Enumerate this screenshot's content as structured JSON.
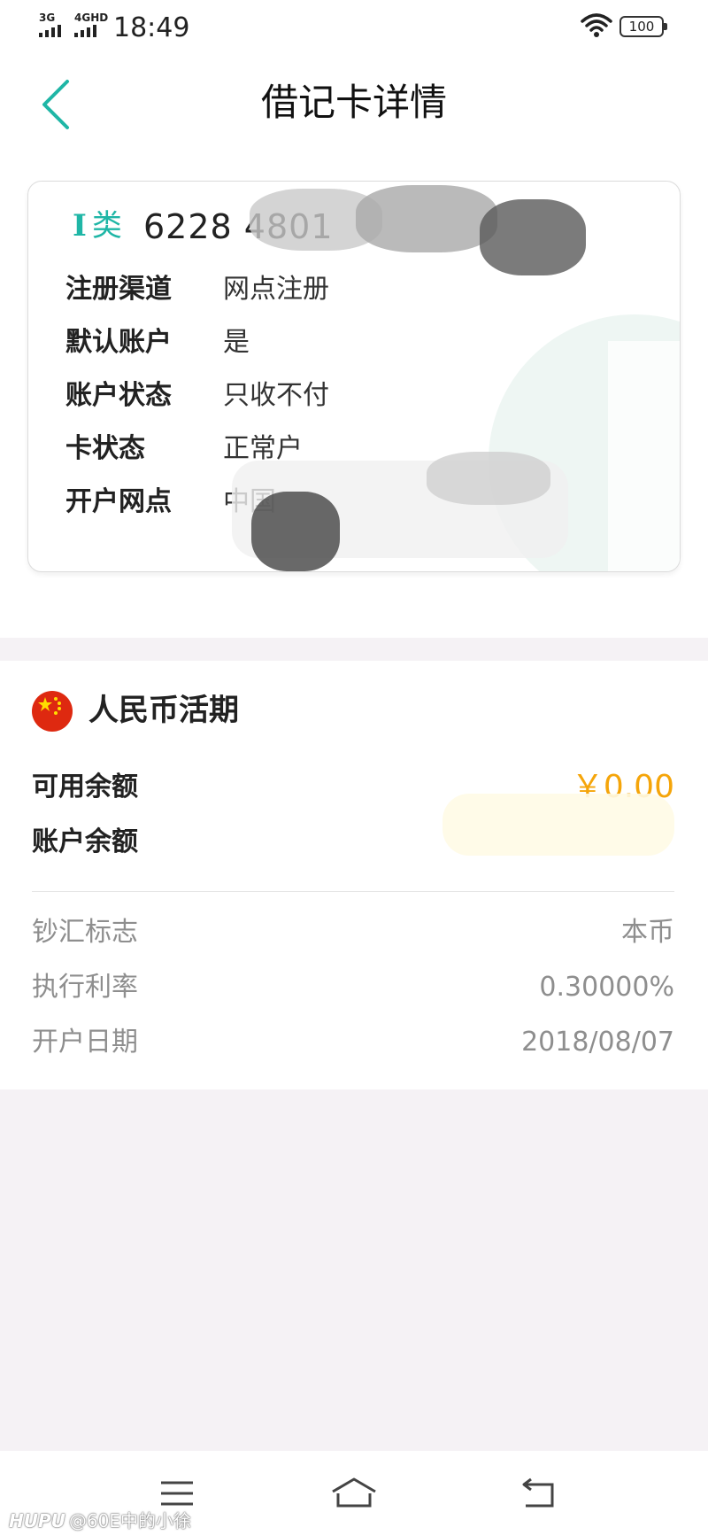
{
  "status_bar": {
    "network_1": "3G",
    "network_2": "4GHD",
    "time": "18:49",
    "battery": "100"
  },
  "nav": {
    "title": "借记卡详情",
    "back_icon": "chevron-left-icon"
  },
  "card": {
    "type_roman": "I",
    "type_label": "类",
    "number_visible": "6228 4801",
    "rows": [
      {
        "label": "注册渠道",
        "value": "网点注册"
      },
      {
        "label": "默认账户",
        "value": "是"
      },
      {
        "label": "账户状态",
        "value": "只收不付"
      },
      {
        "label": "卡状态",
        "value": "正常户"
      },
      {
        "label": "开户网点",
        "value": "中国"
      }
    ]
  },
  "account": {
    "flag_icon": "china-flag-icon",
    "title": "人民币活期",
    "available_label": "可用余额",
    "available_value": "￥0.00",
    "balance_label": "账户余额",
    "details": [
      {
        "label": "钞汇标志",
        "value": "本币"
      },
      {
        "label": "执行利率",
        "value": "0.30000%"
      },
      {
        "label": "开户日期",
        "value": "2018/08/07"
      }
    ]
  },
  "bottom_nav": {
    "menu_icon": "menu-icon",
    "home_icon": "home-icon",
    "back_icon": "back-icon"
  },
  "watermark": {
    "brand": "HUPU",
    "handle": "@60E中的小徐"
  },
  "colors": {
    "accent": "#1fb6a6",
    "gold": "#f5a50a",
    "flag_red": "#de2910",
    "flag_yellow": "#ffde00"
  }
}
